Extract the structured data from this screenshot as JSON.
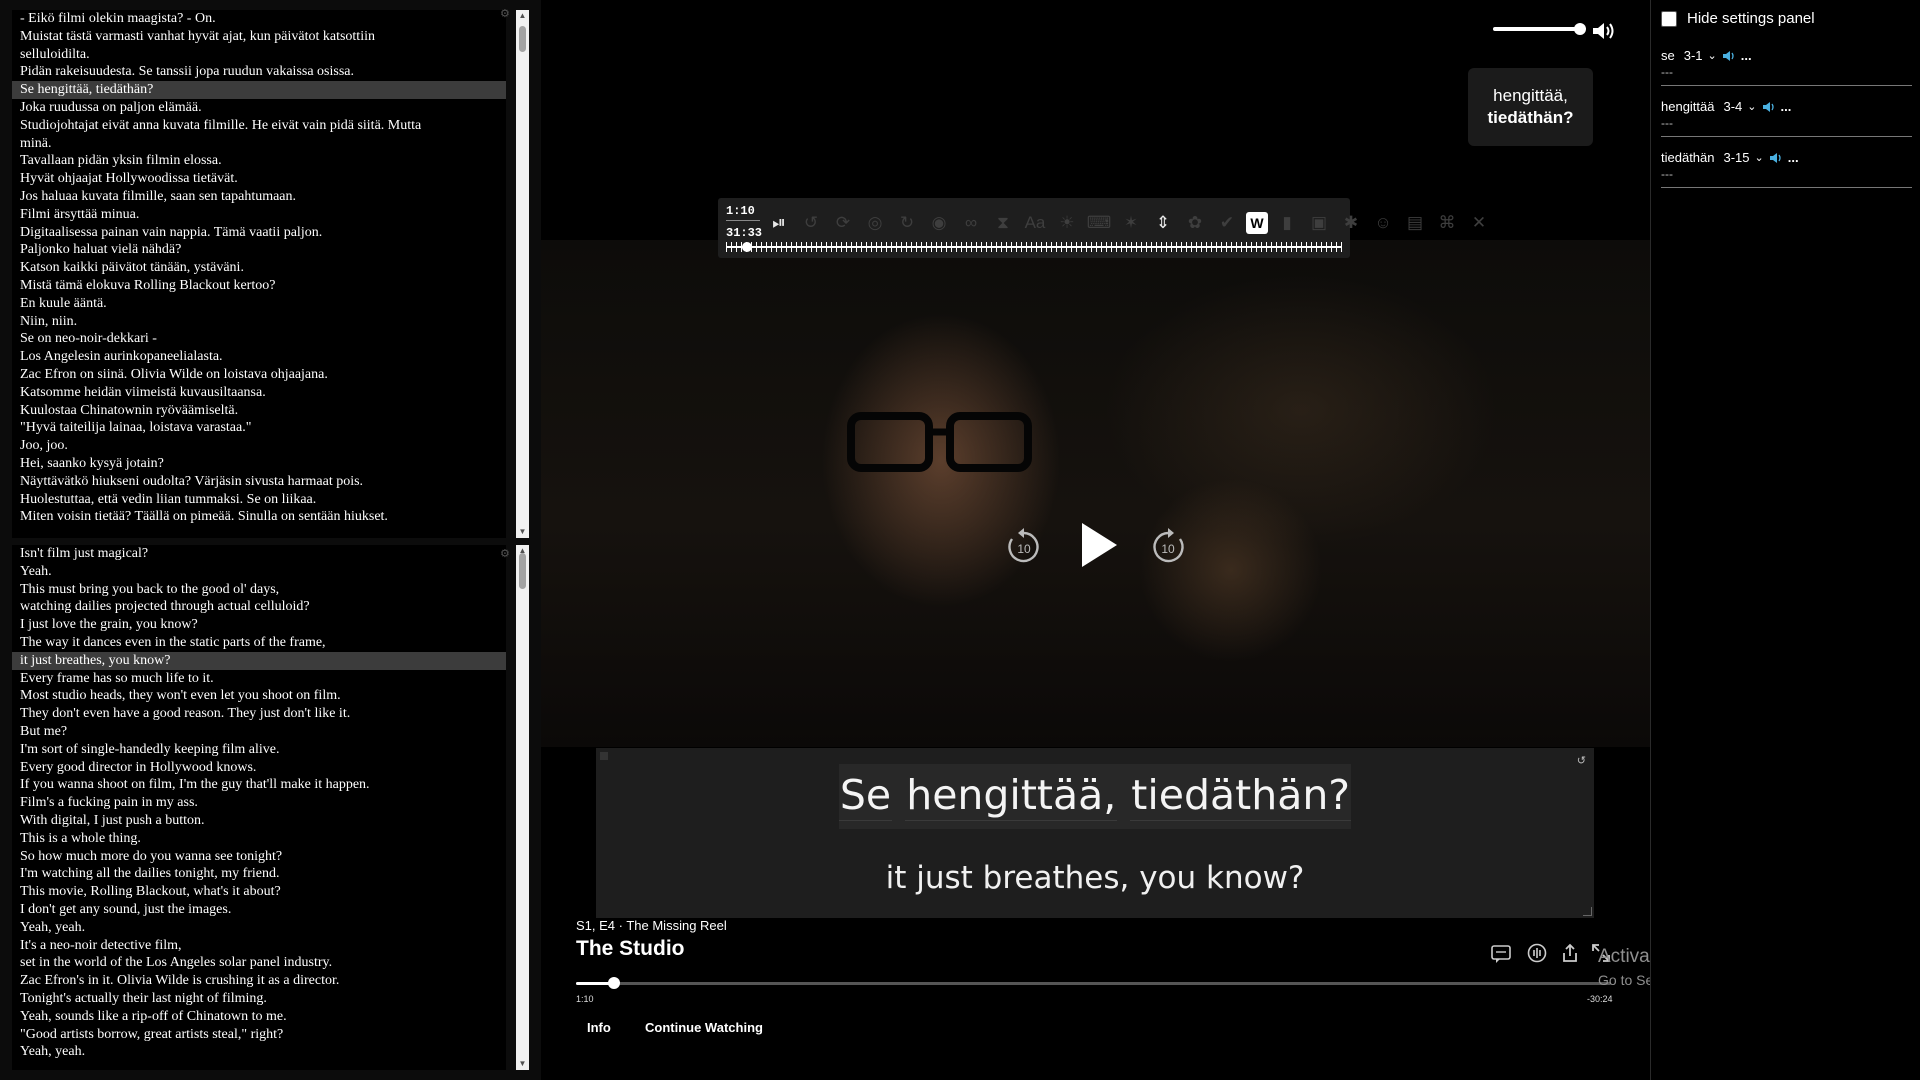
{
  "transcript": {
    "finnish_lines": [
      "- Eikö filmi olekin maagista? - On.",
      "Muistat tästä varmasti vanhat hyvät ajat, kun päivätot katsottiin",
      "selluloidilta.",
      "Pidän rakeisuudesta. Se tanssii jopa ruudun vakaissa osissa.",
      "Se hengittää, tiedäthän?",
      "Joka ruudussa on paljon elämää.",
      "Studiojohtajat eivät anna kuvata filmille. He eivät vain pidä siitä. Mutta",
      "minä.",
      "Tavallaan pidän yksin filmin elossa.",
      "Hyvät ohjaajat Hollywoodissa tietävät.",
      "Jos haluaa kuvata filmille, saan sen tapahtumaan.",
      "Filmi ärsyttää minua.",
      "Digitaalisessa painan vain nappia. Tämä vaatii paljon.",
      "Paljonko haluat vielä nähdä?",
      "Katson kaikki päivätot tänään, ystäväni.",
      "Mistä tämä elokuva Rolling Blackout kertoo?",
      "En kuule ääntä.",
      "Niin, niin.",
      "Se on neo-noir-dekkari -",
      "Los Angelesin aurinkopaneelialasta.",
      "Zac Efron on siinä. Olivia Wilde on loistava ohjaajana.",
      "Katsomme heidän viimeistä kuvausiltaansa.",
      "Kuulostaa Chinatownin ryöväämiseltä.",
      "\"Hyvä taiteilija lainaa, loistava varastaa.\"",
      "Joo, joo.",
      "Hei, saanko kysyä jotain?",
      "Näyttävätkö hiukseni oudolta? Värjäsin sivusta harmaat pois.",
      "Huolestuttaa, että vedin liian tummaksi. Se on liikaa.",
      "Miten voisin tietää? Täällä on pimeää. Sinulla on sentään hiukset."
    ],
    "english_lines": [
      "Isn't film just magical?",
      "Yeah.",
      "This must bring you back to the good ol' days,",
      "watching dailies projected through actual celluloid?",
      "I just love the grain, you know?",
      "The way it dances even in the static parts of the frame,",
      "it just breathes, you know?",
      "Every frame has so much life to it.",
      "Most studio heads, they won't even let you shoot on film.",
      "They don't even have a good reason. They just don't like it.",
      "But me?",
      "I'm sort of single-handedly keeping film alive.",
      "Every good director in Hollywood knows.",
      "If you wanna shoot on film, I'm the guy that'll make it happen.",
      "Film's a fucking pain in my ass.",
      "With digital, I just push a button.",
      "This is a whole thing.",
      "So how much more do you wanna see tonight?",
      "I'm watching all the dailies tonight, my friend.",
      "This movie, Rolling Blackout, what's it about?",
      "I don't get any sound, just the images.",
      "Yeah, yeah.",
      "It's a neo-noir detective film,",
      "set in the world of the Los Angeles solar panel industry.",
      "Zac Efron's in it. Olivia Wilde is crushing it as a director.",
      "Tonight's actually their last night of filming.",
      "Yeah, sounds like a rip-off of Chinatown to me.",
      "\"Good artists borrow, great artists steal,\" right?",
      "Yeah, yeah."
    ],
    "highlight_fi": 4,
    "highlight_en": 6
  },
  "player": {
    "subtitle_bubble_line1": "hengittää,",
    "subtitle_bubble_line2": "tiedäthän?",
    "toolbar_current": "1:10",
    "toolbar_duration": "31:33",
    "subtitle_words": [
      "Se",
      "hengittää,",
      "tiedäthän?"
    ],
    "subtitle_translation": "it just breathes, you know?",
    "episode": "S1, E4 · The Missing Reel",
    "show_title": "The Studio",
    "time_current": "1:10",
    "time_remaining": "-30:24",
    "progress_fraction": 0.037,
    "volume_fraction": 0.95,
    "info_label": "Info",
    "continue_label": "Continue Watching",
    "skip_back_seconds": "10",
    "skip_forward_seconds": "10",
    "toolbar_letter": "W"
  },
  "settings": {
    "hide_label": "Hide settings panel",
    "hide_checked": false,
    "words": [
      {
        "word": "se",
        "ref": "3-1",
        "more": "...",
        "definition": "---"
      },
      {
        "word": "hengittää",
        "ref": "3-4",
        "more": "...",
        "definition": "---"
      },
      {
        "word": "tiedäthän",
        "ref": "3-15",
        "more": "...",
        "definition": "---"
      }
    ]
  },
  "watermark": {
    "line1": "Activate Windows",
    "line2": "Go to Settings to activate Windows."
  },
  "colors": {
    "accent_speaker": "#4ab0e0",
    "highlight_row": "#3c3c3c",
    "panel_bg": "#1e1e1e"
  }
}
